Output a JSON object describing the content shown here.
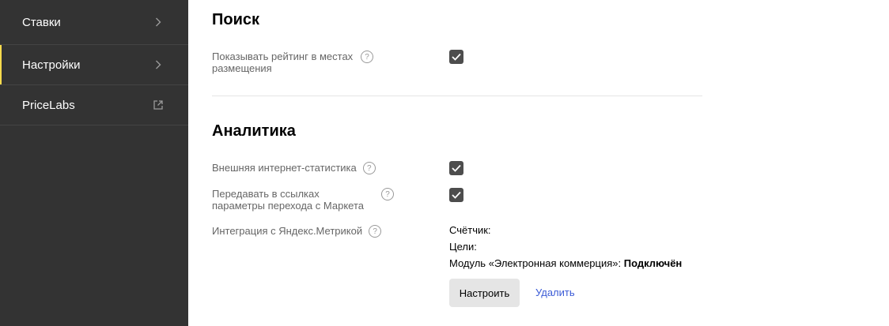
{
  "sidebar": {
    "items": [
      {
        "label": "Ставки",
        "icon": "chevron-right-icon"
      },
      {
        "label": "Настройки",
        "icon": "chevron-right-icon",
        "active": true
      },
      {
        "label": "PriceLabs",
        "icon": "external-link-icon"
      }
    ]
  },
  "search": {
    "title": "Поиск",
    "rating_label": "Показывать рейтинг в местах размещения",
    "rating_checked": true
  },
  "analytics": {
    "title": "Аналитика",
    "external_stats_label": "Внешняя интернет-статистика",
    "external_stats_checked": true,
    "pass_params_label": "Передавать в ссылках параметры перехода с Маркета",
    "pass_params_checked": true,
    "metrika_label": "Интеграция с Яндекс.Метрикой",
    "counter_label": "Счётчик:",
    "goals_label": "Цели:",
    "ecommerce_label": "Модуль «Электронная коммерция»:",
    "ecommerce_status": "Подключён",
    "configure_button": "Настроить",
    "delete_link": "Удалить"
  },
  "help_glyph": "?",
  "colors": {
    "sidebar_bg": "#333333",
    "active_accent": "#ffdb4d",
    "checkbox": "#4d4d4d",
    "link": "#3b5bd6"
  }
}
